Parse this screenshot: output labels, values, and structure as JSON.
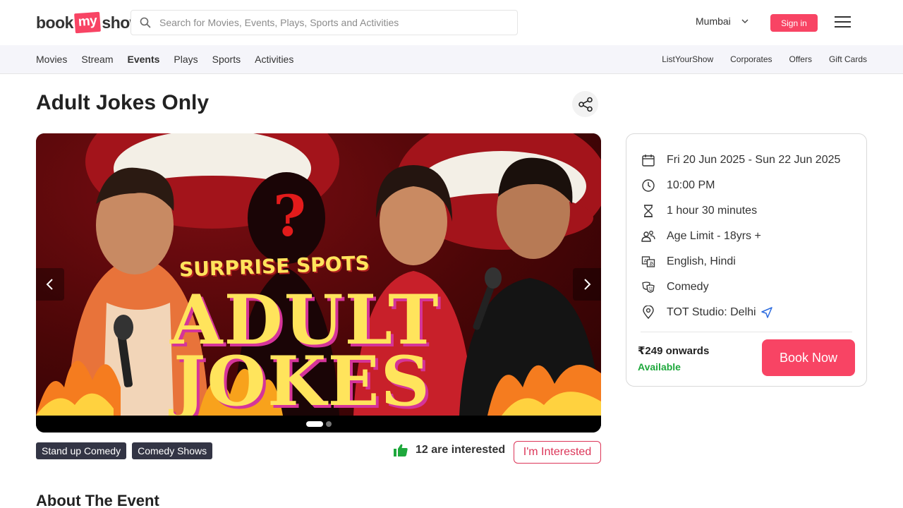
{
  "header": {
    "logo_text_left": "book",
    "logo_text_mid": "my",
    "logo_text_right": "show",
    "search_placeholder": "Search for Movies, Events, Plays, Sports and Activities",
    "city": "Mumbai",
    "signin_label": "Sign in"
  },
  "subnav": {
    "left": [
      "Movies",
      "Stream",
      "Events",
      "Plays",
      "Sports",
      "Activities"
    ],
    "active": "Events",
    "right": [
      "ListYourShow",
      "Corporates",
      "Offers",
      "Gift Cards"
    ]
  },
  "event": {
    "title": "Adult Jokes Only",
    "banner": {
      "line1": "SURPRISE SPOTS",
      "line2": "ADULT",
      "line3": "JOKES",
      "mark": "?",
      "slide_count": 2,
      "active_slide": 1
    },
    "tags": [
      "Stand up Comedy",
      "Comedy Shows"
    ],
    "interested_count": "12 are interested",
    "interested_button": "I'm Interested",
    "about_heading": "About The Event"
  },
  "details": {
    "dates": "Fri 20 Jun 2025 - Sun 22 Jun 2025",
    "time": "10:00 PM",
    "duration": "1 hour 30 minutes",
    "age_limit": "Age Limit - 18yrs +",
    "languages": "English, Hindi",
    "genre": "Comedy",
    "venue": "TOT Studio: Delhi",
    "price": "₹249 onwards",
    "availability": "Available",
    "book_label": "Book Now"
  },
  "colors": {
    "brand": "#f84464",
    "tag_bg": "#333545",
    "available": "#1ea83c",
    "interest_accent": "#dc3558"
  }
}
